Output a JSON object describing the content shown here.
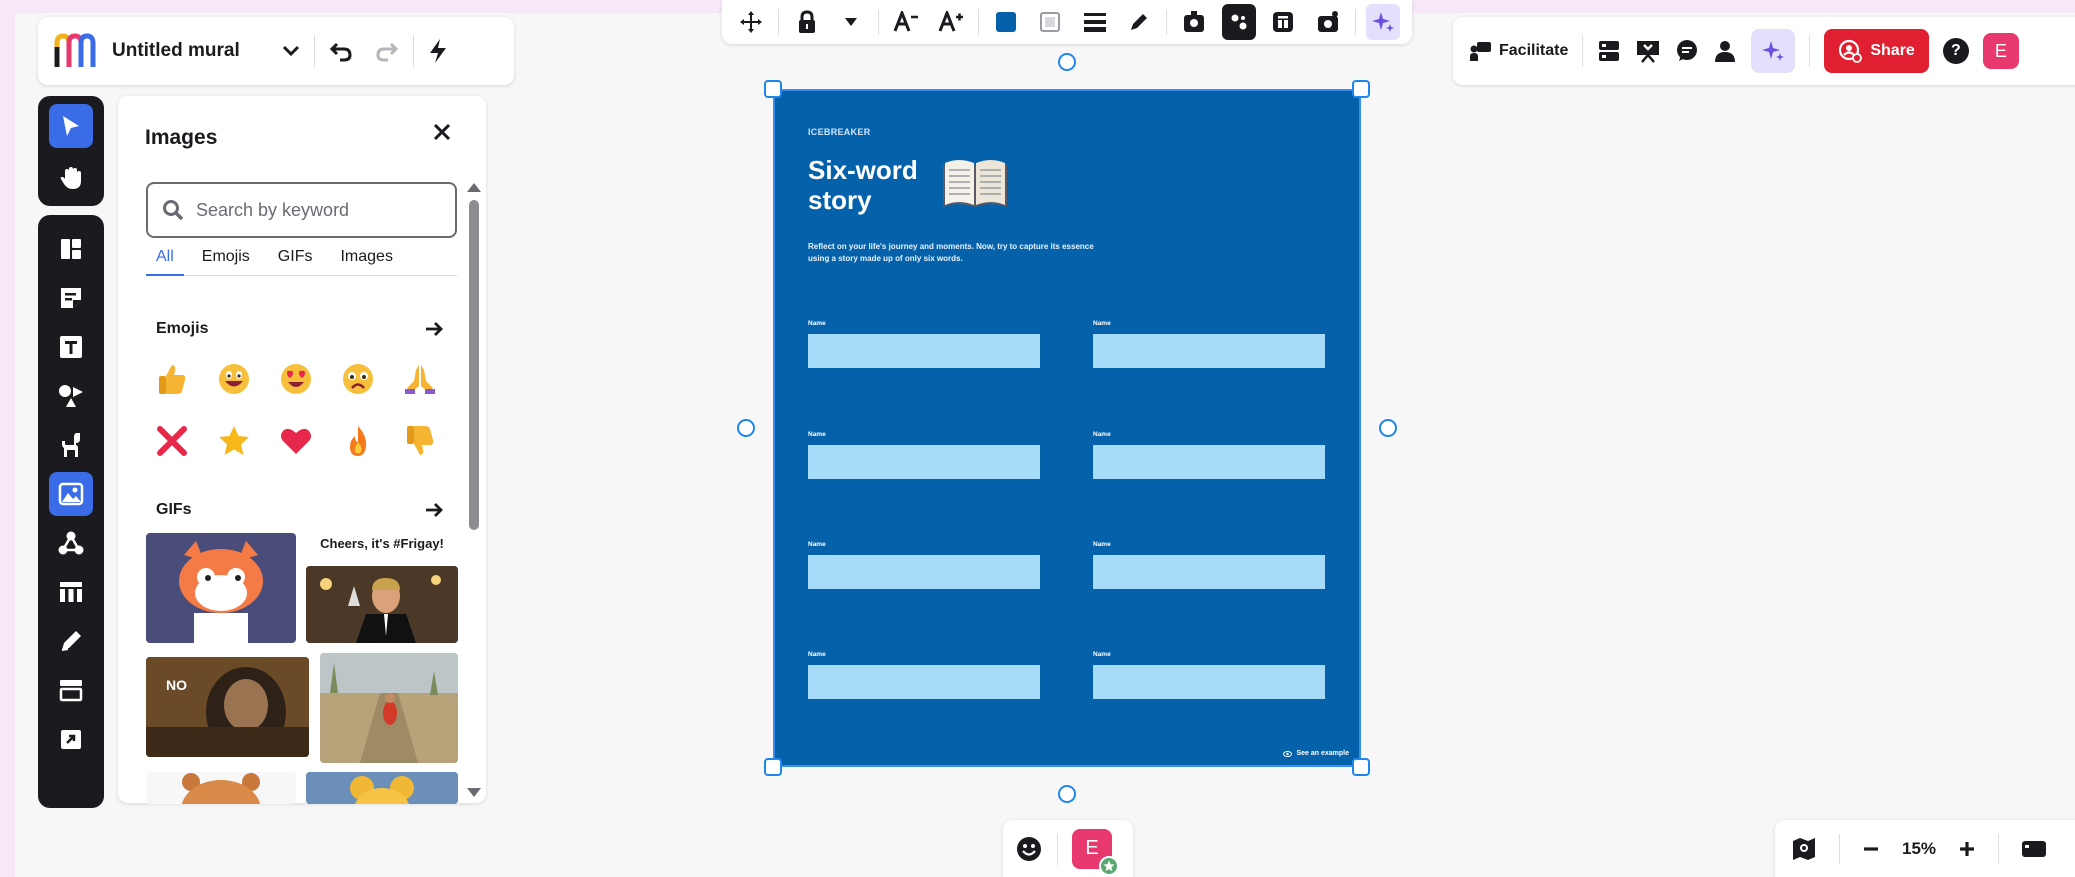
{
  "mural": {
    "title": "Untitled mural"
  },
  "panel": {
    "title": "Images",
    "search_placeholder": "Search by keyword",
    "tabs": [
      {
        "label": "All",
        "active": true
      },
      {
        "label": "Emojis"
      },
      {
        "label": "GIFs"
      },
      {
        "label": "Images"
      }
    ],
    "emojis_heading": "Emojis",
    "emojis": [
      "thumbs-up",
      "grinning-face",
      "heart-eyes-face",
      "worried-face",
      "praying-hands",
      "cross-mark",
      "star",
      "red-heart",
      "fire",
      "thumbs-down"
    ],
    "gifs_heading": "GIFs",
    "gif_captions": {
      "cheers": "Cheers, it's #Frigay!",
      "no": "NO"
    }
  },
  "top_right": {
    "facilitate_label": "Facilitate",
    "share_label": "Share",
    "help_label": "?",
    "avatar_initial": "E"
  },
  "template": {
    "eyebrow": "ICEBREAKER",
    "title": "Six-word story",
    "description": "Reflect on your life's journey and moments. Now, try to capture its essence using a story made up of only six words.",
    "name_label": "Name",
    "example_link": "See an example"
  },
  "bottom": {
    "avatar_initial": "E"
  },
  "zoom": {
    "value": "15%"
  },
  "colors": {
    "accent": "#3b6ce8",
    "share_red": "#e02030",
    "template_bg": "#0562aa",
    "name_box": "#a7dcf8",
    "avatar_pink": "#e8396f"
  }
}
